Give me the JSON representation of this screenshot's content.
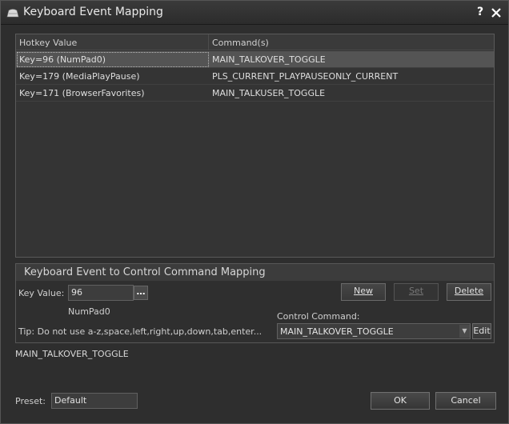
{
  "window": {
    "title": "Keyboard Event Mapping",
    "help": "?"
  },
  "list": {
    "columns": [
      "Hotkey Value",
      "Command(s)"
    ],
    "rows": [
      {
        "hotkey": "Key=96 (NumPad0)",
        "command": "MAIN_TALKOVER_TOGGLE",
        "selected": true
      },
      {
        "hotkey": "Key=179 (MediaPlayPause)",
        "command": "PLS_CURRENT_PLAYPAUSEONLY_CURRENT",
        "selected": false
      },
      {
        "hotkey": "Key=171 (BrowserFavorites)",
        "command": "MAIN_TALKUSER_TOGGLE",
        "selected": false
      }
    ]
  },
  "mapping": {
    "title": "Keyboard Event to Control Command Mapping",
    "key_value_label": "Key Value:",
    "key_value": "96",
    "key_name": "NumPad0",
    "browse_label": "…",
    "new_label": "New",
    "set_label": "Set",
    "delete_label": "Delete",
    "control_command_label": "Control Command:",
    "control_command_value": "MAIN_TALKOVER_TOGGLE",
    "edit_label": "Edit",
    "tip": "Tip: Do not use a-z,space,left,right,up,down,tab,enter..."
  },
  "status_text": "MAIN_TALKOVER_TOGGLE",
  "preset": {
    "label": "Preset:",
    "value": "Default"
  },
  "footer": {
    "ok_label": "OK",
    "cancel_label": "Cancel"
  },
  "colors": {
    "background": "#2e2e2e",
    "selected_row": "#545454",
    "text": "#cfcfcf"
  }
}
